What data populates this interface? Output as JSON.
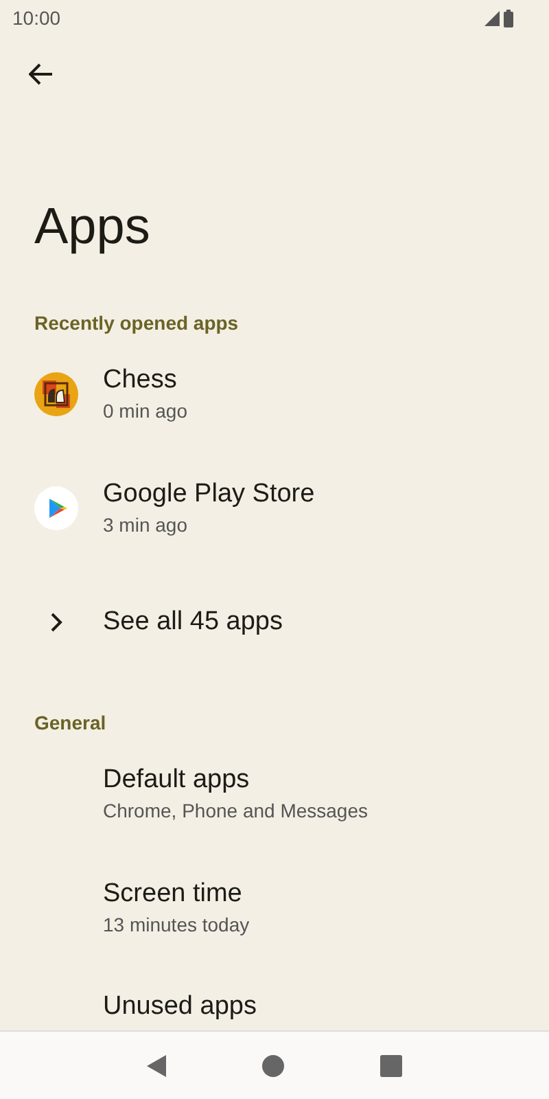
{
  "status_bar": {
    "time": "10:00"
  },
  "title": "Apps",
  "sections": [
    {
      "header": "Recently opened apps",
      "items": [
        {
          "kind": "app",
          "title": "Chess",
          "subtitle": "0 min ago"
        },
        {
          "kind": "app",
          "title": "Google Play Store",
          "subtitle": "3 min ago"
        },
        {
          "kind": "link",
          "title": "See all 45 apps"
        }
      ]
    },
    {
      "header": "General",
      "items": [
        {
          "kind": "text",
          "title": "Default apps",
          "subtitle": "Chrome, Phone and Messages"
        },
        {
          "kind": "text",
          "title": "Screen time",
          "subtitle": "13 minutes today"
        },
        {
          "kind": "text",
          "title": "Unused apps"
        }
      ]
    }
  ]
}
